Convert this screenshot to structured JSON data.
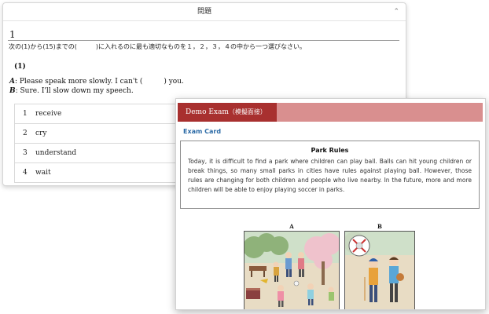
{
  "question_window": {
    "header_title": "問題",
    "collapse_icon": "chevron-up-icon",
    "question_number": "1",
    "instruction": "次の(1)から(15)までの(　　　)に入れるのに最も適切なものを１，２，３，４の中から一つ選びなさい。",
    "sub_number": "(1)",
    "dialogue": {
      "a_speaker": "A",
      "a_text": ": Please speak more slowly. I can't (　　　) you.",
      "b_speaker": "B",
      "b_text": ": Sure. I'll slow down my speech."
    },
    "options": [
      {
        "num": "1",
        "text": "receive"
      },
      {
        "num": "2",
        "text": "cry"
      },
      {
        "num": "3",
        "text": "understand"
      },
      {
        "num": "4",
        "text": "wait"
      }
    ]
  },
  "exam_window": {
    "header_title": "Demo Exam",
    "header_subtitle": "（模擬面接）",
    "section_label": "Exam Card",
    "passage_title": "Park Rules",
    "passage_text": "Today, it is difficult to find a park where children can play ball. Balls can hit young children or break things, so many small parks in cities have rules against playing ball. However, those rules are changing for both children and people who live nearby. In the future, more and more children will be able to enjoy playing soccer in parks.",
    "picture_a_label": "A",
    "picture_b_label": "B",
    "colors": {
      "header_dark": "#a8302f",
      "header_light": "#d98f8f",
      "link_blue": "#2b6aa6"
    }
  }
}
